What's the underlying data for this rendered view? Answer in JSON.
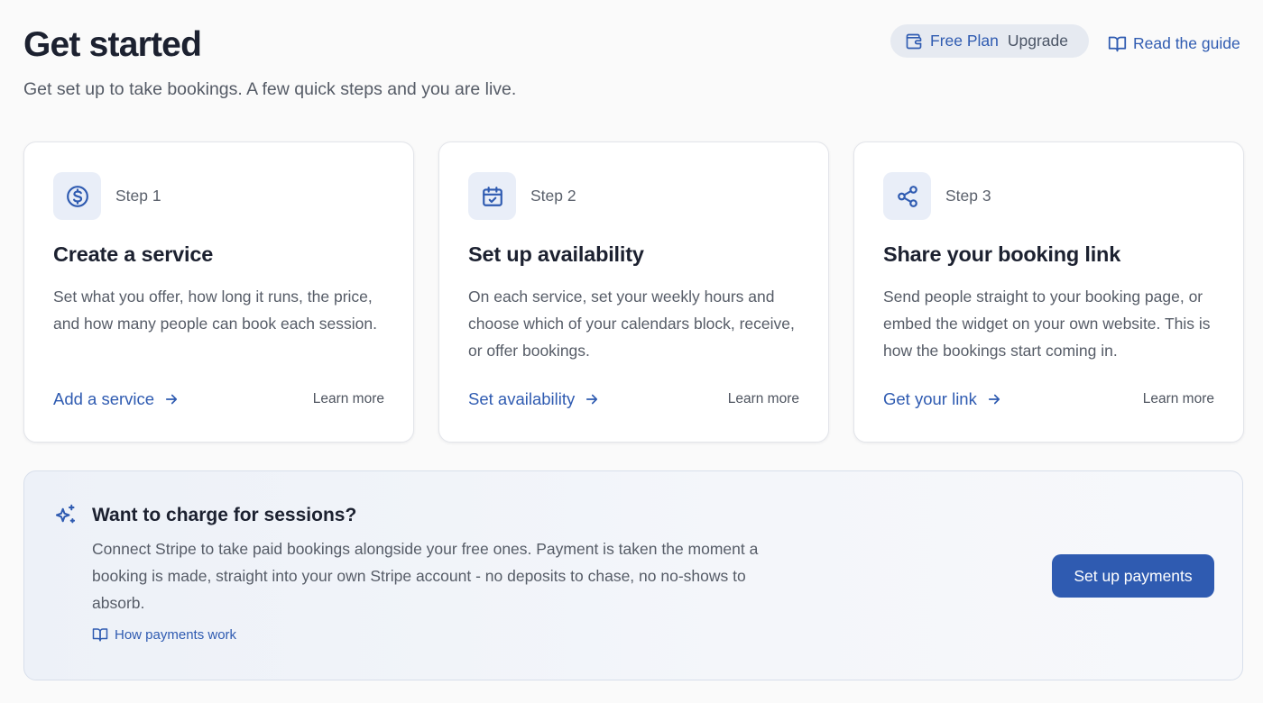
{
  "header": {
    "title": "Get started",
    "subtitle": "Get set up to take bookings. A few quick steps and you are live.",
    "plan": {
      "icon": "wallet-icon",
      "name": "Free Plan",
      "upgrade_label": "Upgrade"
    },
    "guide": {
      "icon": "book-open-icon",
      "label": "Read the guide"
    }
  },
  "steps": [
    {
      "icon": "dollar-circle-icon",
      "step_label": "Step 1",
      "title": "Create a service",
      "description": "Set what you offer, how long it runs, the price, and how many people can book each session.",
      "action_label": "Add a service",
      "learn_more": "Learn more"
    },
    {
      "icon": "calendar-check-icon",
      "step_label": "Step 2",
      "title": "Set up availability",
      "description": "On each service, set your weekly hours and choose which of your calendars block, receive, or offer bookings.",
      "action_label": "Set availability",
      "learn_more": "Learn more"
    },
    {
      "icon": "share-icon",
      "step_label": "Step 3",
      "title": "Share your booking link",
      "description": "Send people straight to your booking page, or embed the widget on your own website. This is how the bookings start coming in.",
      "action_label": "Get your link",
      "learn_more": "Learn more"
    }
  ],
  "payments": {
    "icon": "sparkles-icon",
    "title": "Want to charge for sessions?",
    "description": "Connect Stripe to take paid bookings alongside your free ones. Payment is taken the moment a booking is made, straight into your own Stripe account - no deposits to chase, no no-shows to absorb.",
    "link_label": "How payments work",
    "button_label": "Set up payments"
  },
  "colors": {
    "accent": "#2f5bb1",
    "background": "#fafafa",
    "icon_tile": "#e9eef8",
    "card_border": "#e3e5ea"
  }
}
